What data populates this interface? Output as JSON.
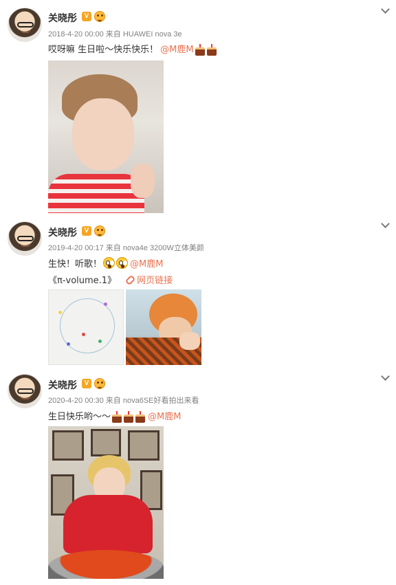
{
  "posts": [
    {
      "author": "关晓彤",
      "verified_badge": "V",
      "meta": "2018-4-20 00:00 来自 HUAWEI nova 3e",
      "text": "哎呀嘛 生日啦～快乐快乐！",
      "mention": "@M鹿M",
      "emojis": [
        "cake-icon",
        "cake-icon"
      ]
    },
    {
      "author": "关晓彤",
      "verified_badge": "V",
      "meta": "2019-4-20 00:17 来自 nova4e 3200W立体美颜",
      "text": "生快！听歌！",
      "mention": "@M鹿M",
      "emojis": [
        "scared-face-icon",
        "scared-face-icon"
      ],
      "song": "《π-volume.1》",
      "link_label": "网页链接"
    },
    {
      "author": "关晓彤",
      "verified_badge": "V",
      "meta": "2020-4-20 00:30 来自 nova6SE好看拍出来看",
      "text": "生日快乐哟～～",
      "mention": "@M鹿M",
      "emojis": [
        "cake-icon",
        "cake-icon",
        "cake-icon"
      ]
    }
  ],
  "colors": {
    "mention": "#eb7350",
    "meta": "#808080",
    "verified": "#f5a623"
  }
}
